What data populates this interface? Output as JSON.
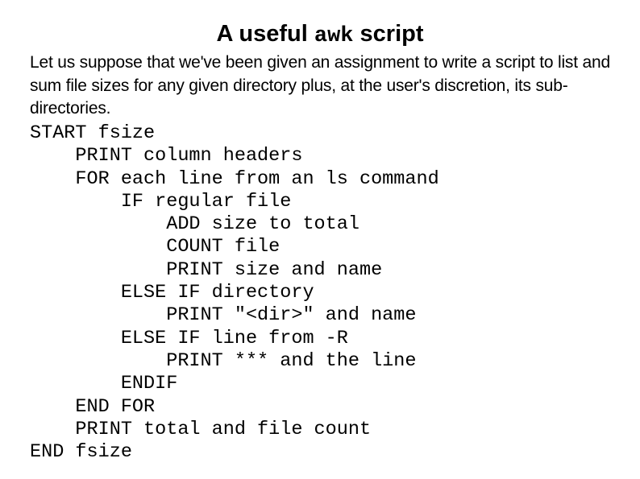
{
  "slide": {
    "title_prefix": "A useful ",
    "title_code": "awk",
    "title_suffix": " script",
    "intro": "Let us suppose that we've been given an assignment to write a script to list and sum file sizes for any given directory plus, at the user's discretion, its sub-directories.",
    "pseudocode": [
      "START fsize",
      "    PRINT column headers",
      "    FOR each line from an ls command",
      "        IF regular file",
      "            ADD size to total",
      "            COUNT file",
      "            PRINT size and name",
      "        ELSE IF directory",
      "            PRINT \"<dir>\" and name",
      "        ELSE IF line from -R",
      "            PRINT *** and the line",
      "        ENDIF",
      "    END FOR",
      "    PRINT total and file count",
      "END fsize"
    ]
  }
}
